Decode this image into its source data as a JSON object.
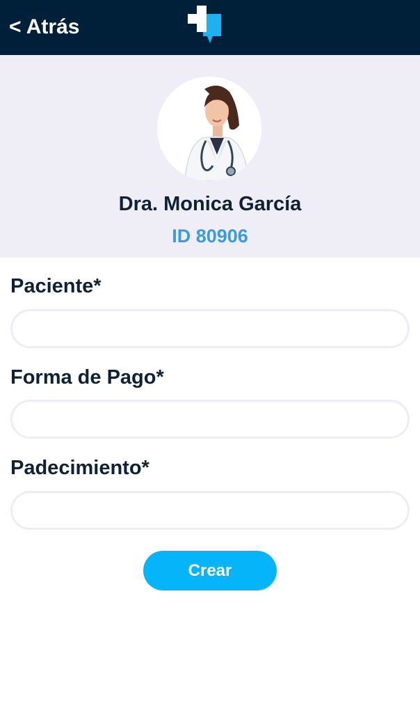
{
  "header": {
    "back_label": "< Atrás",
    "logo_icon": "medical-cross-chat-icon",
    "colors": {
      "background": "#002039",
      "logo_white": "#ffffff",
      "logo_blue": "#1fb0f0"
    }
  },
  "profile": {
    "avatar_icon": "doctor-photo",
    "name": "Dra. Monica García",
    "id_label": "ID 80906",
    "colors": {
      "background": "#efeef6",
      "name": "#0e2234",
      "id": "#3b9be0"
    }
  },
  "form": {
    "fields": [
      {
        "label": "Paciente*",
        "value": "",
        "placeholder": ""
      },
      {
        "label": "Forma de Pago*",
        "value": "",
        "placeholder": ""
      },
      {
        "label": "Padecimiento*",
        "value": "",
        "placeholder": ""
      }
    ],
    "submit_label": "Crear",
    "colors": {
      "button": "#06b4fa",
      "input_border": "#eeedf5"
    }
  }
}
